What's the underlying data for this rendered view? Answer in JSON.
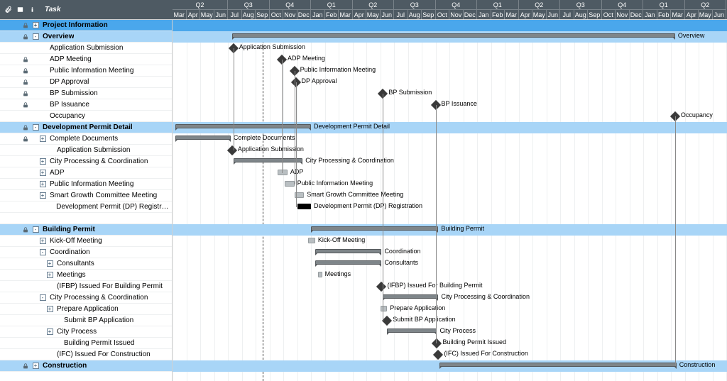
{
  "header": {
    "task_col": "Task"
  },
  "timeline": {
    "month_width": 19.5,
    "start_month": 0,
    "today_month": 6.5
  },
  "quarters": [
    "Q2",
    "Q3",
    "Q4",
    "Q1",
    "Q2",
    "Q3",
    "Q4",
    "Q1",
    "Q2",
    "Q3",
    "Q4",
    "Q1",
    "Q2"
  ],
  "quarter_spans": [
    4,
    3,
    3,
    3,
    3,
    3,
    3,
    3,
    3,
    3,
    3,
    3,
    3
  ],
  "months": [
    "Mar",
    "Apr",
    "May",
    "Jun",
    "Jul",
    "Aug",
    "Sep",
    "Oct",
    "Nov",
    "Dec",
    "Jan",
    "Feb",
    "Mar",
    "Apr",
    "May",
    "Jun",
    "Jul",
    "Aug",
    "Sep",
    "Oct",
    "Nov",
    "Dec",
    "Jan",
    "Feb",
    "Mar",
    "Apr",
    "May",
    "Jun",
    "Jul",
    "Aug",
    "Sep",
    "Oct",
    "Nov",
    "Dec",
    "Jan",
    "Feb",
    "Mar",
    "Apr",
    "May",
    "Jun"
  ],
  "rows": [
    {
      "id": "proj-info",
      "label": "Project Information",
      "indent": 0,
      "lock": true,
      "expand": "+",
      "section": "dark"
    },
    {
      "id": "overview",
      "label": "Overview",
      "indent": 0,
      "lock": true,
      "expand": "-",
      "section": "light",
      "bar": {
        "type": "summary",
        "start": 4.3,
        "end": 36.3,
        "label": "Overview",
        "labelSide": "right"
      }
    },
    {
      "id": "app-sub",
      "label": "Application Submission",
      "indent": 1,
      "lock": false,
      "ms": {
        "at": 4.4,
        "label": "Application Submission",
        "vline": true
      }
    },
    {
      "id": "adp-mtg",
      "label": "ADP Meeting",
      "indent": 1,
      "lock": true,
      "ms": {
        "at": 7.9,
        "label": "ADP Meeting",
        "vline": true
      }
    },
    {
      "id": "pub-info",
      "label": "Public Information Meeting",
      "indent": 1,
      "lock": true,
      "ms": {
        "at": 8.8,
        "label": "Public Information Meeting",
        "vline": true
      }
    },
    {
      "id": "dp-appr",
      "label": "DP Approval",
      "indent": 1,
      "lock": true,
      "ms": {
        "at": 8.9,
        "label": "DP Approval",
        "vline": true
      }
    },
    {
      "id": "bp-sub",
      "label": "BP Submission",
      "indent": 1,
      "lock": true,
      "ms": {
        "at": 15.2,
        "label": "BP Submission",
        "vline": true
      }
    },
    {
      "id": "bp-iss",
      "label": "BP Issuance",
      "indent": 1,
      "lock": true,
      "ms": {
        "at": 19.0,
        "label": "BP Issuance",
        "vline": true
      }
    },
    {
      "id": "occ",
      "label": "Occupancy",
      "indent": 1,
      "lock": false,
      "ms": {
        "at": 36.3,
        "label": "Occupancy",
        "vline": true
      }
    },
    {
      "id": "dev-permit",
      "label": "Development Permit Detail",
      "indent": 0,
      "lock": true,
      "expand": "-",
      "section": "light",
      "bar": {
        "type": "summary",
        "start": 0.2,
        "end": 10.0,
        "label": "Development Permit Detail",
        "labelSide": "right"
      }
    },
    {
      "id": "comp-docs",
      "label": "Complete Documents",
      "indent": 1,
      "lock": true,
      "expand": "+",
      "bar": {
        "type": "summary",
        "start": 0.2,
        "end": 4.2,
        "label": "Complete Documents",
        "labelSide": "right"
      }
    },
    {
      "id": "dp-app-sub",
      "label": "Application Submission",
      "indent": 2,
      "lock": false,
      "ms": {
        "at": 4.3,
        "label": "Application Submission"
      }
    },
    {
      "id": "city-proc",
      "label": "City Processing & Coordination",
      "indent": 1,
      "lock": false,
      "expand": "+",
      "bar": {
        "type": "summary",
        "start": 4.4,
        "end": 9.4,
        "label": "City Processing & Coordination",
        "labelSide": "right"
      }
    },
    {
      "id": "adp",
      "label": "ADP",
      "indent": 1,
      "lock": false,
      "expand": "+",
      "bar": {
        "type": "task",
        "start": 7.6,
        "end": 8.3,
        "label": "ADP",
        "labelSide": "right"
      }
    },
    {
      "id": "pub-info2",
      "label": "Public Information Meeting",
      "indent": 1,
      "lock": false,
      "expand": "+",
      "bar": {
        "type": "task",
        "start": 8.1,
        "end": 8.8,
        "label": "Public Information Meeting",
        "labelSide": "right"
      }
    },
    {
      "id": "sgc",
      "label": "Smart Growth Committee Meeting",
      "indent": 1,
      "lock": false,
      "expand": "+",
      "bar": {
        "type": "task",
        "start": 8.8,
        "end": 9.5,
        "label": "Smart Growth Committee Meeting",
        "labelSide": "right"
      }
    },
    {
      "id": "dp-reg",
      "label": "Development Permit (DP) Registration",
      "indent": 2,
      "lock": false,
      "bar": {
        "type": "dark",
        "start": 9.0,
        "end": 10.0,
        "label": "Development Permit (DP) Registration",
        "labelSide": "right"
      }
    },
    {
      "id": "spacer1",
      "label": "",
      "indent": 0,
      "lock": false
    },
    {
      "id": "bld-permit",
      "label": "Building Permit",
      "indent": 0,
      "lock": true,
      "expand": "-",
      "section": "light",
      "bar": {
        "type": "summary",
        "start": 10.0,
        "end": 19.2,
        "label": "Building Permit",
        "labelSide": "right"
      }
    },
    {
      "id": "kickoff",
      "label": "Kick-Off Meeting",
      "indent": 1,
      "lock": false,
      "expand": "+",
      "bar": {
        "type": "task",
        "start": 9.8,
        "end": 10.3,
        "label": "Kick-Off Meeting",
        "labelSide": "right"
      }
    },
    {
      "id": "coord",
      "label": "Coordination",
      "indent": 1,
      "lock": false,
      "expand": "-",
      "bar": {
        "type": "summary",
        "start": 10.3,
        "end": 15.1,
        "label": "Coordination",
        "labelSide": "right"
      }
    },
    {
      "id": "consult",
      "label": "Consultants",
      "indent": 2,
      "lock": false,
      "expand": "+",
      "bar": {
        "type": "summary",
        "start": 10.3,
        "end": 15.1,
        "label": "Consultants",
        "labelSide": "right"
      }
    },
    {
      "id": "meetings",
      "label": "Meetings",
      "indent": 2,
      "lock": false,
      "expand": "+",
      "bar": {
        "type": "task",
        "start": 10.5,
        "end": 10.8,
        "label": "Meetings",
        "labelSide": "right"
      }
    },
    {
      "id": "ifbp",
      "label": "(IFBP) Issued For Building Permit",
      "indent": 2,
      "lock": false,
      "ms": {
        "at": 15.1,
        "label": "(IFBP) Issued For Building Permit"
      }
    },
    {
      "id": "city-proc2",
      "label": "City Processing & Coordination",
      "indent": 1,
      "lock": false,
      "expand": "-",
      "bar": {
        "type": "summary",
        "start": 15.2,
        "end": 19.2,
        "label": "City Processing & Coordination",
        "labelSide": "right"
      }
    },
    {
      "id": "prep-app",
      "label": "Prepare Application",
      "indent": 2,
      "lock": false,
      "expand": "+",
      "bar": {
        "type": "task",
        "start": 15.0,
        "end": 15.5,
        "label": "Prepare Application",
        "labelSide": "right"
      }
    },
    {
      "id": "submit-bp",
      "label": "Submit BP Application",
      "indent": 3,
      "lock": false,
      "ms": {
        "at": 15.5,
        "label": "Submit BP Application"
      }
    },
    {
      "id": "city-process",
      "label": "City Process",
      "indent": 2,
      "lock": false,
      "expand": "+",
      "bar": {
        "type": "summary",
        "start": 15.5,
        "end": 19.1,
        "label": "City Process",
        "labelSide": "right"
      }
    },
    {
      "id": "bp-issued",
      "label": "Building Permit Issued",
      "indent": 3,
      "lock": false,
      "ms": {
        "at": 19.1,
        "label": "Building Permit Issued"
      }
    },
    {
      "id": "ifc",
      "label": "(IFC) Issued For Construction",
      "indent": 2,
      "lock": false,
      "ms": {
        "at": 19.2,
        "label": "(IFC) Issued For Construction"
      }
    },
    {
      "id": "construction",
      "label": "Construction",
      "indent": 0,
      "lock": true,
      "expand": "+",
      "section": "light",
      "bar": {
        "type": "summary",
        "start": 19.3,
        "end": 36.4,
        "label": "Construction",
        "labelSide": "right"
      }
    }
  ],
  "vlines": [
    {
      "at": 4.4,
      "from": 2,
      "to": 11
    },
    {
      "at": 7.9,
      "from": 3,
      "to": 13
    },
    {
      "at": 8.8,
      "from": 4,
      "to": 14
    },
    {
      "at": 8.9,
      "from": 5,
      "to": 16
    },
    {
      "at": 15.2,
      "from": 6,
      "to": 26
    },
    {
      "at": 19.0,
      "from": 7,
      "to": 28
    },
    {
      "at": 36.3,
      "from": 8,
      "to": 30
    }
  ]
}
